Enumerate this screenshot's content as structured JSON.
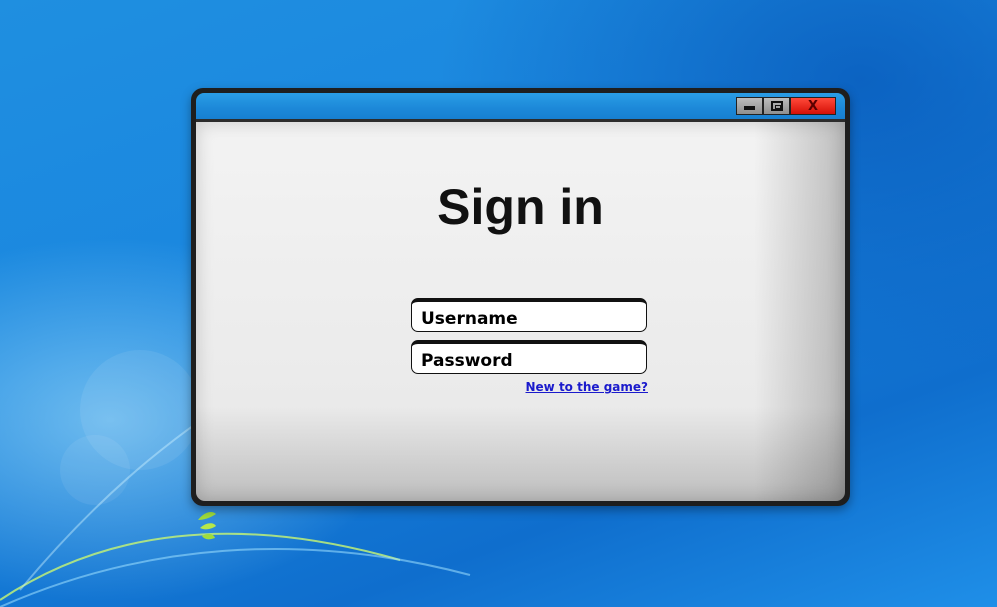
{
  "window": {
    "controls": {
      "minimize_icon": "minimize-icon",
      "maximize_icon": "maximize-icon",
      "close_icon": "close-icon",
      "close_glyph": "X"
    }
  },
  "signin": {
    "title": "Sign in",
    "username_placeholder": "Username",
    "password_placeholder": "Password",
    "new_user_link": "New to the game?"
  },
  "colors": {
    "desktop": "#1a86df",
    "close_button": "#e3170d",
    "link": "#1a1acc"
  }
}
